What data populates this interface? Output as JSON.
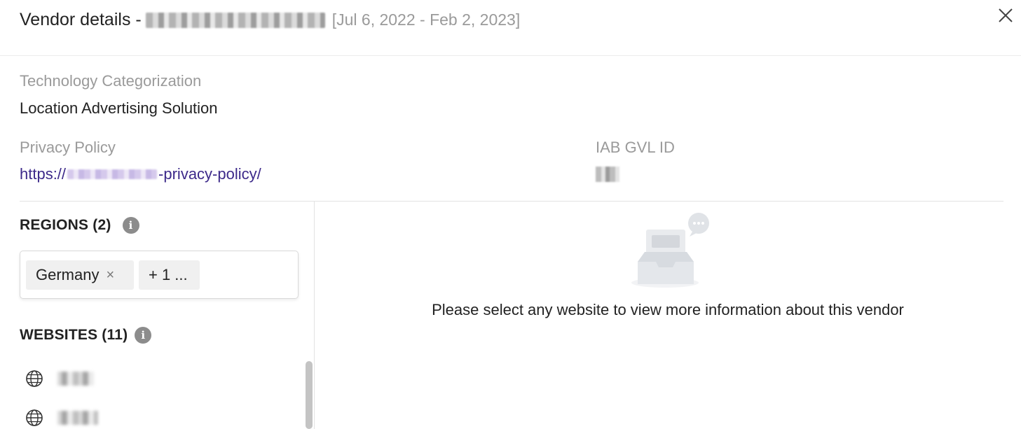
{
  "header": {
    "title": "Vendor details -",
    "date_range": "[Jul 6, 2022 - Feb 2, 2023]",
    "close_icon": "close-icon"
  },
  "details": {
    "technology_label": "Technology Categorization",
    "technology_value": "Location Advertising Solution",
    "privacy_label": "Privacy Policy",
    "privacy_prefix": "https://",
    "privacy_suffix": "-privacy-policy/",
    "iab_label": "IAB GVL ID"
  },
  "regions": {
    "heading": "REGIONS (2)",
    "info_icon": "i",
    "chips": [
      {
        "label": "Germany",
        "remove": "×"
      },
      {
        "label": "+ 1 ..."
      }
    ]
  },
  "websites": {
    "heading": "WEBSITES (11)",
    "info_icon": "i",
    "icon": "globe-icon"
  },
  "empty_state": {
    "message": "Please select any website to view more information about this vendor",
    "icon": "inbox-illustration"
  }
}
